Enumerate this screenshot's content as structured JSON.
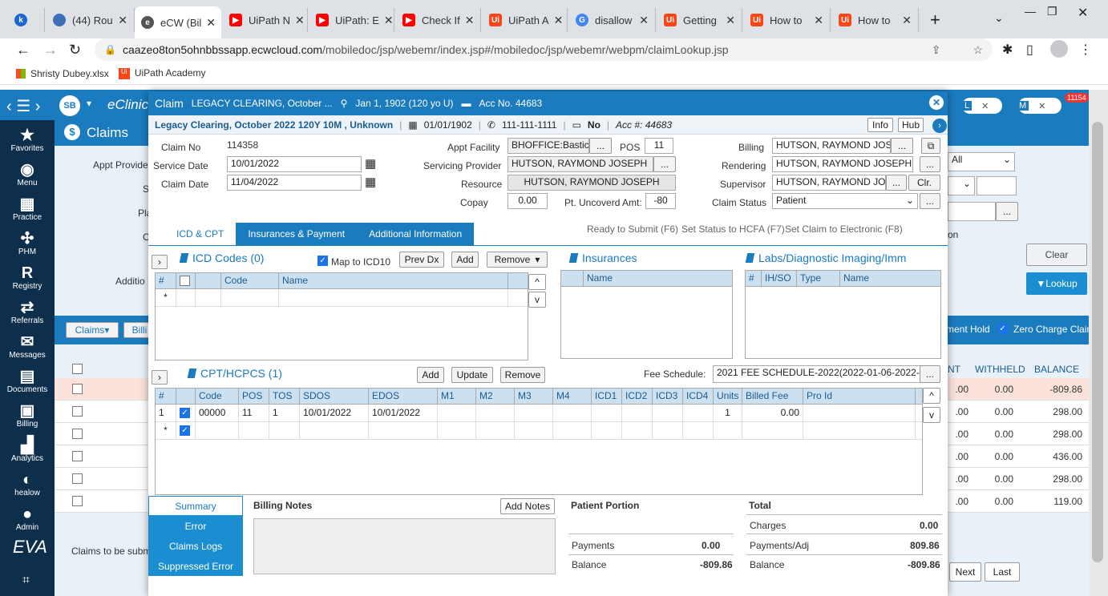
{
  "browser": {
    "tabs": [
      {
        "label": "k",
        "icon": "k-app-icon",
        "color": "#1967d2"
      },
      {
        "label": "(44) Rou",
        "icon": "globe-icon",
        "color": "#3c6fb5"
      },
      {
        "label": "eCW (Bil",
        "icon": "ecw-icon",
        "color": "#555555"
      },
      {
        "label": "UiPath N",
        "icon": "youtube-icon",
        "color": "#ff0000"
      },
      {
        "label": "UiPath: E",
        "icon": "youtube-icon",
        "color": "#ff0000"
      },
      {
        "label": "Check If",
        "icon": "youtube-icon",
        "color": "#ff0000"
      },
      {
        "label": "UiPath A",
        "icon": "uipath-icon",
        "color": "#fa4616"
      },
      {
        "label": "disallow",
        "icon": "google-icon",
        "color": "#4285f4"
      },
      {
        "label": "Getting",
        "icon": "uipath-icon",
        "color": "#fa4616"
      },
      {
        "label": "How to",
        "icon": "uipath-icon",
        "color": "#fa4616"
      },
      {
        "label": "How to",
        "icon": "uipath-icon",
        "color": "#fa4616"
      }
    ],
    "url_host": "caazeo8ton5ohnbbssapp.ecwcloud.com",
    "url_path": "/mobiledoc/jsp/webemr/index.jsp#/mobiledoc/jsp/webemr/webpm/claimLookup.jsp",
    "bookmarks": [
      "Shristy Dubey.xlsx",
      "UiPath Academy"
    ]
  },
  "app": {
    "avatar": "SB",
    "brand": "eClinic",
    "module": "Claims",
    "badge": "11154",
    "pill_l": "L",
    "pill_m": "M",
    "nav": [
      "Favorites",
      "Menu",
      "Practice",
      "PHM",
      "Registry",
      "Referrals",
      "Messages",
      "Documents",
      "Billing",
      "Analytics",
      "healow",
      "Admin"
    ]
  },
  "bg": {
    "appt_provider": "Appt Provide",
    "service_s": "S",
    "pla": "Pla",
    "c_label": "C",
    "additio": "Additio",
    "all": "All",
    "on_label": "on",
    "clear": "Clear",
    "lookup": "Lookup",
    "claims_btn": "Claims",
    "billi_btn": "Billi",
    "payment_hold": "ment Hold",
    "zero_charge": "Zero Charge Claim",
    "col_nt": "NT",
    "col_withheld": "WITHHELD",
    "col_balance": "BALANCE",
    "rows": [
      {
        "nt": ".00",
        "withheld": "0.00",
        "balance": "-809.86"
      },
      {
        "nt": ".00",
        "withheld": "0.00",
        "balance": "298.00"
      },
      {
        "nt": ".00",
        "withheld": "0.00",
        "balance": "298.00"
      },
      {
        "nt": ".00",
        "withheld": "0.00",
        "balance": "436.00"
      },
      {
        "nt": ".00",
        "withheld": "0.00",
        "balance": "298.00"
      },
      {
        "nt": ".00",
        "withheld": "0.00",
        "balance": "119.00"
      }
    ],
    "claims_to_be": "Claims to be subm",
    "next": "Next",
    "last": "Last"
  },
  "dialog": {
    "title": "Claim",
    "subtitle": "LEGACY CLEARING, October ...",
    "dob": "Jan 1, 1902 (120 yo U)",
    "acc": "Acc No. 44683",
    "patient": "Legacy Clearing, October 2022 120Y 10M , Unknown",
    "dob2": "01/01/1902",
    "phone": "111-111-1111",
    "no": "No",
    "acc2": "Acc #: 44683",
    "info": "Info",
    "hub": "Hub",
    "claim_no_label": "Claim No",
    "claim_no": "114358",
    "service_date_label": "Service Date",
    "service_date": "10/01/2022",
    "claim_date_label": "Claim Date",
    "claim_date": "11/04/2022",
    "appt_facility_label": "Appt Facility",
    "appt_facility": "BHOFFICE:Bastic",
    "pos_label": "POS",
    "pos": "11",
    "servicing_label": "Servicing Provider",
    "servicing": "HUTSON, RAYMOND JOSEPH",
    "resource_label": "Resource",
    "resource": "HUTSON, RAYMOND JOSEPH",
    "copay_label": "Copay",
    "copay": "0.00",
    "uncovered_label": "Pt. Uncoverd Amt:",
    "uncovered": "-80",
    "billing_label": "Billing",
    "billing": "HUTSON, RAYMOND JOS",
    "rendering_label": "Rendering",
    "rendering": "HUTSON, RAYMOND JOSEPH",
    "supervisor_label": "Supervisor",
    "supervisor": "HUTSON, RAYMOND JO",
    "clr": "Clr.",
    "status_label": "Claim Status",
    "status": "Patient",
    "ellipsis": "...",
    "tabs": [
      "ICD & CPT",
      "Insurances & Payment",
      "Additional Information"
    ],
    "actions": [
      "Ready to Submit (F6)",
      "Set Status to HCFA (F7)",
      "Set Claim to Electronic (F8)"
    ],
    "icd_title": "ICD Codes (0)",
    "map_icd10": "Map to ICD10",
    "prev_dx": "Prev Dx",
    "add": "Add",
    "remove": "Remove",
    "update": "Update",
    "icd_cols": [
      "#",
      "",
      "Code",
      "Name"
    ],
    "ins_title": "Insurances",
    "ins_cols": [
      "Name"
    ],
    "labs_title": "Labs/Diagnostic Imaging/Imm",
    "labs_cols": [
      "#",
      "IH/SO",
      "Type",
      "Name"
    ],
    "cpt_title": "CPT/HCPCS (1)",
    "fee_label": "Fee Schedule:",
    "fee": "2021 FEE SCHEDULE-2022(2022-01-06-2022-1",
    "cpt_cols": [
      "#",
      "",
      "Code",
      "POS",
      "TOS",
      "SDOS",
      "EDOS",
      "M1",
      "M2",
      "M3",
      "M4",
      "ICD1",
      "ICD2",
      "ICD3",
      "ICD4",
      "Units",
      "Billed Fee",
      "Pro Id"
    ],
    "cpt_row": {
      "n": "1",
      "code": "00000",
      "pos": "11",
      "tos": "1",
      "sdos": "10/01/2022",
      "edos": "10/01/2022",
      "units": "1",
      "fee": "0.00"
    },
    "star": "*",
    "side": [
      "Summary",
      "Error",
      "Claims Logs",
      "Suppressed Error"
    ],
    "billing_notes": "Billing Notes",
    "add_notes": "Add Notes",
    "patient_portion": "Patient Portion",
    "payments_label": "Payments",
    "payments": "0.00",
    "balance_label": "Balance",
    "balance": "-809.86",
    "total": "Total",
    "charges_label": "Charges",
    "charges": "0.00",
    "payadj_label": "Payments/Adj",
    "payadj": "809.86",
    "total_balance": "-809.86"
  }
}
